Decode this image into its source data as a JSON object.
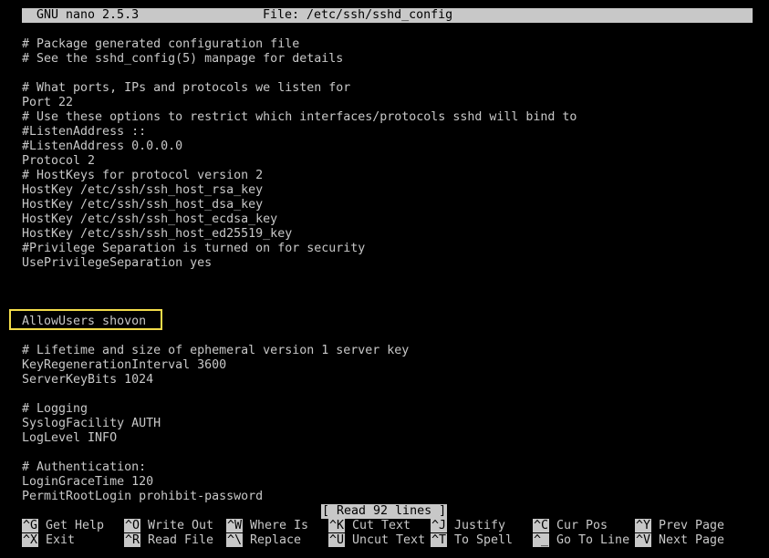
{
  "title_bar": {
    "app": "GNU nano 2.5.3",
    "file": "File: /etc/ssh/sshd_config"
  },
  "editor": {
    "lines": [
      "",
      "# Package generated configuration file",
      "# See the sshd_config(5) manpage for details",
      "",
      "# What ports, IPs and protocols we listen for",
      "Port 22",
      "# Use these options to restrict which interfaces/protocols sshd will bind to",
      "#ListenAddress ::",
      "#ListenAddress 0.0.0.0",
      "Protocol 2",
      "# HostKeys for protocol version 2",
      "HostKey /etc/ssh/ssh_host_rsa_key",
      "HostKey /etc/ssh/ssh_host_dsa_key",
      "HostKey /etc/ssh/ssh_host_ecdsa_key",
      "HostKey /etc/ssh/ssh_host_ed25519_key",
      "#Privilege Separation is turned on for security",
      "UsePrivilegeSeparation yes",
      "",
      "",
      "",
      "AllowUsers shovon",
      "",
      "# Lifetime and size of ephemeral version 1 server key",
      "KeyRegenerationInterval 3600",
      "ServerKeyBits 1024",
      "",
      "# Logging",
      "SyslogFacility AUTH",
      "LogLevel INFO",
      "",
      "# Authentication:",
      "LoginGraceTime 120",
      "PermitRootLogin prohibit-password"
    ]
  },
  "status": "[ Read 92 lines ]",
  "shortcuts": [
    {
      "key": "^G",
      "label": "Get Help"
    },
    {
      "key": "^O",
      "label": "Write Out"
    },
    {
      "key": "^W",
      "label": "Where Is"
    },
    {
      "key": "^K",
      "label": "Cut Text"
    },
    {
      "key": "^J",
      "label": "Justify"
    },
    {
      "key": "^C",
      "label": "Cur Pos"
    },
    {
      "key": "^Y",
      "label": "Prev Page"
    },
    {
      "key": "^X",
      "label": "Exit"
    },
    {
      "key": "^R",
      "label": "Read File"
    },
    {
      "key": "^\\",
      "label": "Replace"
    },
    {
      "key": "^U",
      "label": "Uncut Text"
    },
    {
      "key": "^T",
      "label": "To Spell"
    },
    {
      "key": "^_",
      "label": "Go To Line"
    },
    {
      "key": "^V",
      "label": "Next Page"
    }
  ],
  "colors": {
    "background": "#000000",
    "foreground": "#c8c8c8",
    "highlight_border": "#f3dc4a"
  }
}
